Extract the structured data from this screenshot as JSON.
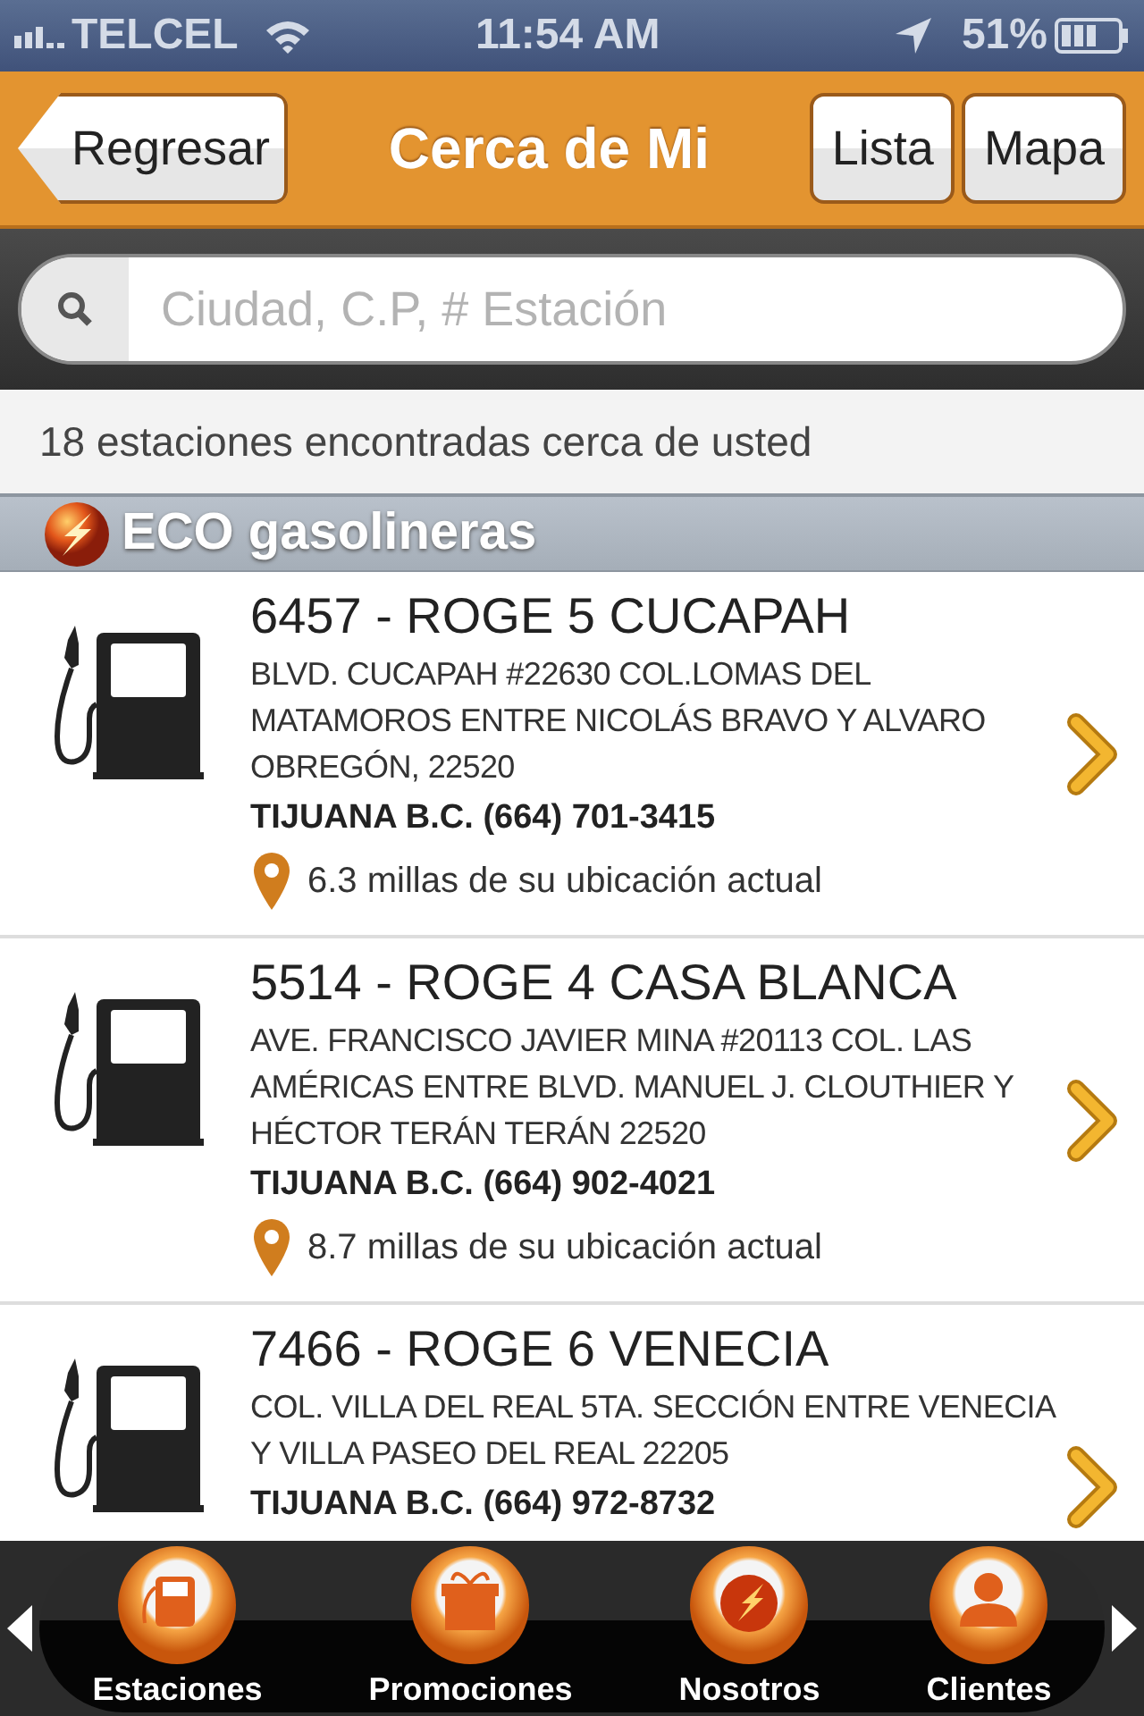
{
  "status_bar": {
    "carrier": "TELCEL",
    "time": "11:54 AM",
    "battery": "51%"
  },
  "nav": {
    "back": "Regresar",
    "title": "Cerca de Mi",
    "buttons": [
      "Lista",
      "Mapa"
    ]
  },
  "search": {
    "placeholder": "Ciudad, C.P, # Estación"
  },
  "result_count": "18 estaciones encontradas cerca de usted",
  "section": {
    "title": "ECO gasolineras"
  },
  "stations": [
    {
      "name": "6457 - ROGE 5 CUCAPAH",
      "address": "BLVD. CUCAPAH #22630 COL.LOMAS DEL MATAMOROS ENTRE NICOLÁS BRAVO Y ALVARO OBREGÓN, 22520",
      "city_phone": "TIJUANA B.C. (664) 701-3415",
      "distance": "6.3 millas de su ubicación actual"
    },
    {
      "name": "5514 - ROGE 4 CASA BLANCA",
      "address": "AVE. FRANCISCO JAVIER MINA #20113 COL. LAS AMÉRICAS ENTRE BLVD. MANUEL J. CLOUTHIER Y HÉCTOR TERÁN TERÁN 22520",
      "city_phone": "TIJUANA B.C. (664) 902-4021",
      "distance": "8.7 millas de su ubicación actual"
    },
    {
      "name": "7466 - ROGE 6 VENECIA",
      "address": "COL. VILLA DEL REAL 5TA. SECCIÓN ENTRE VENECIA Y VILLA PASEO DEL REAL 22205",
      "city_phone": "TIJUANA B.C. (664) 972-8732"
    }
  ],
  "tab_bar": [
    {
      "label": "Estaciones",
      "kind": "pump"
    },
    {
      "label": "Promociones",
      "kind": "gift"
    },
    {
      "label": "Nosotros",
      "kind": "logo"
    },
    {
      "label": "Clientes",
      "kind": "person"
    }
  ]
}
